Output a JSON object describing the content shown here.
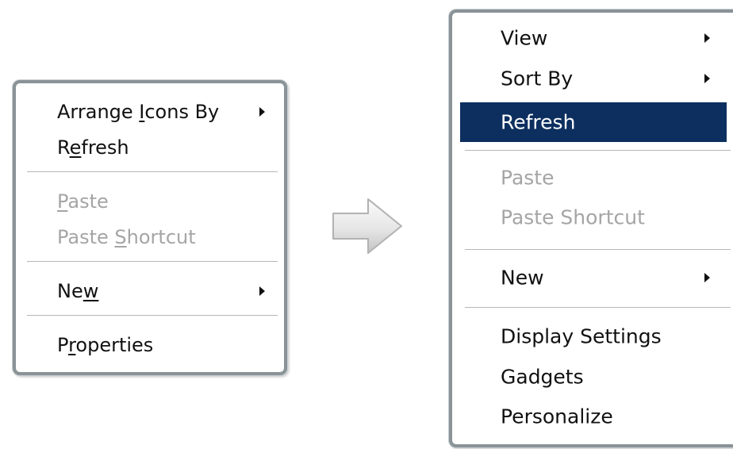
{
  "xp_menu": {
    "items": [
      {
        "pre": "Arrange ",
        "accel": "I",
        "post": "cons By",
        "submenu": true,
        "disabled": false
      },
      {
        "pre": "R",
        "accel": "e",
        "post": "fresh",
        "submenu": false,
        "disabled": false
      },
      {
        "pre": "",
        "accel": "P",
        "post": "aste",
        "submenu": false,
        "disabled": true
      },
      {
        "pre": "Paste ",
        "accel": "S",
        "post": "hortcut",
        "submenu": false,
        "disabled": true
      },
      {
        "pre": "Ne",
        "accel": "w",
        "post": "",
        "submenu": true,
        "disabled": false
      },
      {
        "pre": "P",
        "accel": "r",
        "post": "operties",
        "submenu": false,
        "disabled": false
      }
    ]
  },
  "vista_menu": {
    "items": [
      {
        "label": "View",
        "submenu": true,
        "disabled": false,
        "selected": false
      },
      {
        "label": "Sort By",
        "submenu": true,
        "disabled": false,
        "selected": false
      },
      {
        "label": "Refresh",
        "submenu": false,
        "disabled": false,
        "selected": true
      },
      {
        "label": "Paste",
        "submenu": false,
        "disabled": true,
        "selected": false
      },
      {
        "label": "Paste Shortcut",
        "submenu": false,
        "disabled": true,
        "selected": false
      },
      {
        "label": "New",
        "submenu": true,
        "disabled": false,
        "selected": false
      },
      {
        "label": "Display Settings",
        "submenu": false,
        "disabled": false,
        "selected": false
      },
      {
        "label": "Gadgets",
        "submenu": false,
        "disabled": false,
        "selected": false
      },
      {
        "label": "Personalize",
        "submenu": false,
        "disabled": false,
        "selected": false
      }
    ]
  },
  "transition_icon": "right-arrow-icon",
  "colors": {
    "frame_border": "#8a9397",
    "highlight": "#0d2f5f",
    "disabled_text": "#a5a5a5"
  }
}
